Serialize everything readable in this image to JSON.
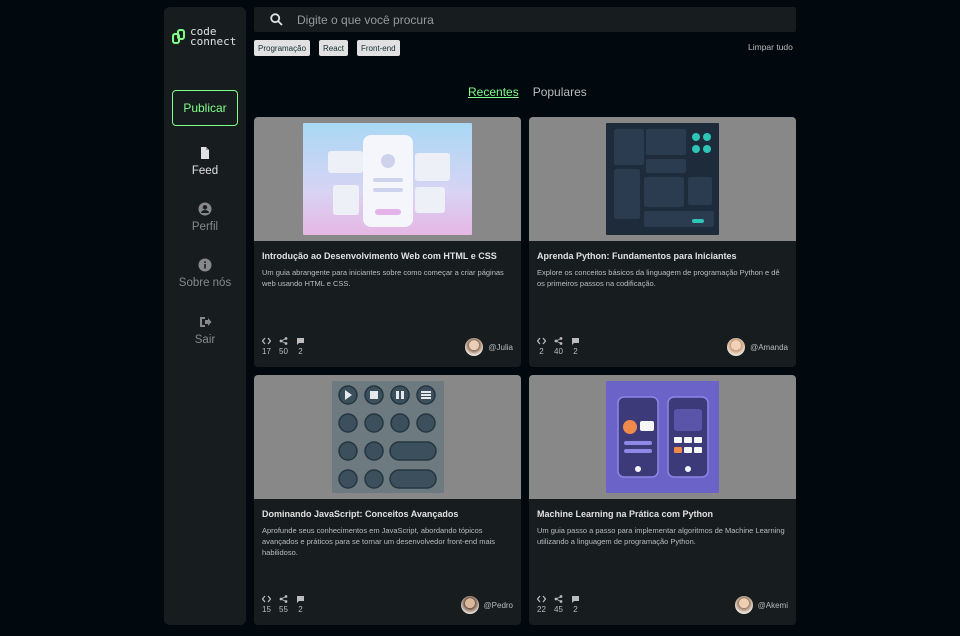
{
  "app": {
    "logo_line1": "code",
    "logo_line2": "connect"
  },
  "sidebar": {
    "publish_label": "Publicar",
    "items": [
      {
        "label": "Feed",
        "icon": "document-icon",
        "active": true
      },
      {
        "label": "Perfil",
        "icon": "user-circle-icon",
        "active": false
      },
      {
        "label": "Sobre nós",
        "icon": "info-icon",
        "active": false
      },
      {
        "label": "Sair",
        "icon": "logout-icon",
        "active": false
      }
    ]
  },
  "search": {
    "placeholder": "Digite o que você procura"
  },
  "tags": [
    "Programação",
    "React",
    "Front-end"
  ],
  "clear_label": "Limpar tudo",
  "tabs": [
    {
      "label": "Recentes",
      "active": true
    },
    {
      "label": "Populares",
      "active": false
    }
  ],
  "colors": {
    "accent": "#81fe88",
    "surface": "#171d1f",
    "background": "#01080e",
    "thumb_bg": "#888888"
  },
  "cards": [
    {
      "title": "Introdução ao Desenvolvimento Web com HTML e CSS",
      "description": "Um guia abrangente para iniciantes sobre como começar a criar páginas web usando HTML e CSS.",
      "code": "17",
      "shares": "50",
      "comments": "2",
      "author": "@Julia"
    },
    {
      "title": "Aprenda Python: Fundamentos para Iniciantes",
      "description": "Explore os conceitos básicos da linguagem de programação Python e dê os primeiros passos na codificação.",
      "code": "2",
      "shares": "40",
      "comments": "2",
      "author": "@Amanda"
    },
    {
      "title": "Dominando JavaScript: Conceitos Avançados",
      "description": "Aprofunde seus conhecimentos em JavaScript, abordando tópicos avançados e práticos para se tornar um desenvolvedor front-end mais habilidoso.",
      "code": "15",
      "shares": "55",
      "comments": "2",
      "author": "@Pedro"
    },
    {
      "title": "Machine Learning na Prática com Python",
      "description": "Um guia passo a passo para implementar algoritmos de Machine Learning utilizando a linguagem de programação Python.",
      "code": "22",
      "shares": "45",
      "comments": "2",
      "author": "@Akemi"
    }
  ]
}
